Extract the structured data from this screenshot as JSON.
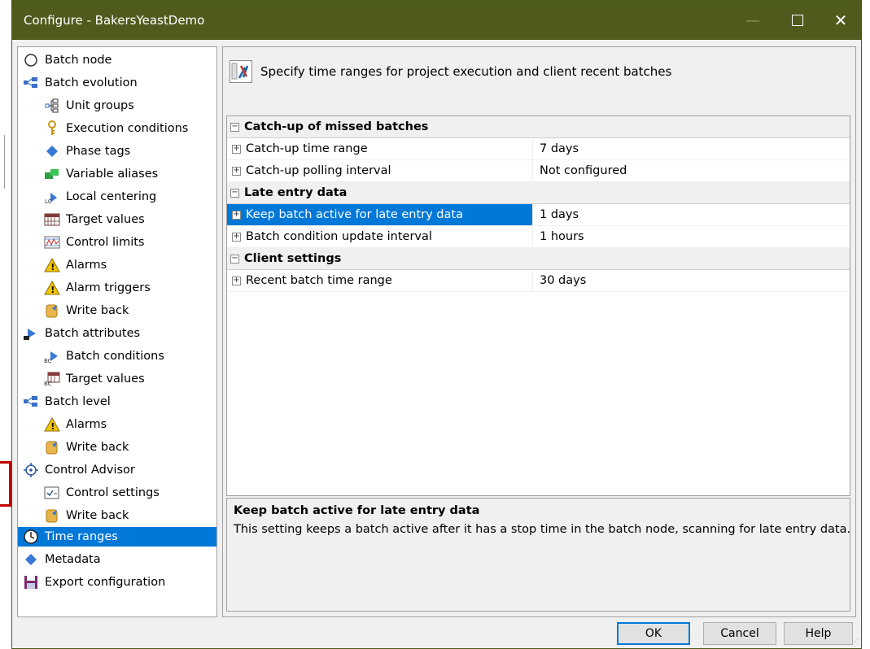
{
  "window": {
    "title": "Configure - BakersYeastDemo",
    "controls": {
      "minimize": "—",
      "close": "✕"
    }
  },
  "tree": {
    "items": [
      {
        "label": "Batch node",
        "icon": "circle-node-icon"
      },
      {
        "label": "Batch evolution",
        "icon": "evolution-icon"
      },
      {
        "label": "Unit groups",
        "icon": "unit-groups-icon"
      },
      {
        "label": "Execution conditions",
        "icon": "key-icon"
      },
      {
        "label": "Phase tags",
        "icon": "diamond-icon"
      },
      {
        "label": "Variable aliases",
        "icon": "aliases-icon"
      },
      {
        "label": "Local centering",
        "icon": "local-centering-icon"
      },
      {
        "label": "Target values",
        "icon": "grid-target-icon"
      },
      {
        "label": "Control limits",
        "icon": "control-limits-icon"
      },
      {
        "label": "Alarms",
        "icon": "warning-icon"
      },
      {
        "label": "Alarm triggers",
        "icon": "warning-icon"
      },
      {
        "label": "Write back",
        "icon": "write-back-icon"
      },
      {
        "label": "Batch attributes",
        "icon": "batch-attributes-icon"
      },
      {
        "label": "Batch conditions",
        "icon": "batch-conditions-icon"
      },
      {
        "label": "Target values",
        "icon": "bc-target-icon"
      },
      {
        "label": "Batch level",
        "icon": "evolution-icon"
      },
      {
        "label": "Alarms",
        "icon": "warning-icon"
      },
      {
        "label": "Write back",
        "icon": "write-back-icon"
      },
      {
        "label": "Control Advisor",
        "icon": "crosshair-icon"
      },
      {
        "label": "Control settings",
        "icon": "checkbox-icon"
      },
      {
        "label": "Write back",
        "icon": "write-back-icon"
      },
      {
        "label": "Time ranges",
        "icon": "clock-icon"
      },
      {
        "label": "Metadata",
        "icon": "diamond-icon"
      },
      {
        "label": "Export configuration",
        "icon": "floppy-icon"
      }
    ]
  },
  "header": {
    "text": "Specify time ranges for project execution and client recent batches"
  },
  "grid": {
    "sections": [
      {
        "title": "Catch-up of missed batches",
        "toggle": "−",
        "rows": [
          {
            "name": "Catch-up time range",
            "value": "7 days"
          },
          {
            "name": "Catch-up polling interval",
            "value": "Not configured"
          }
        ]
      },
      {
        "title": "Late entry data",
        "toggle": "−",
        "rows": [
          {
            "name": "Keep batch active for late entry data",
            "value": "1 days"
          },
          {
            "name": "Batch condition update interval",
            "value": "1 hours"
          }
        ]
      },
      {
        "title": "Client settings",
        "toggle": "−",
        "rows": [
          {
            "name": "Recent batch time range",
            "value": "30 days"
          }
        ]
      }
    ],
    "row_toggle": "+"
  },
  "description": {
    "title": "Keep batch active for late entry data",
    "text": "This setting keeps a batch active after it has a stop time in the batch node, scanning for late entry data."
  },
  "buttons": {
    "ok": "OK",
    "cancel": "Cancel",
    "help": "Help"
  },
  "colors": {
    "titlebar": "#4e5b1d",
    "selection": "#0078d7"
  }
}
